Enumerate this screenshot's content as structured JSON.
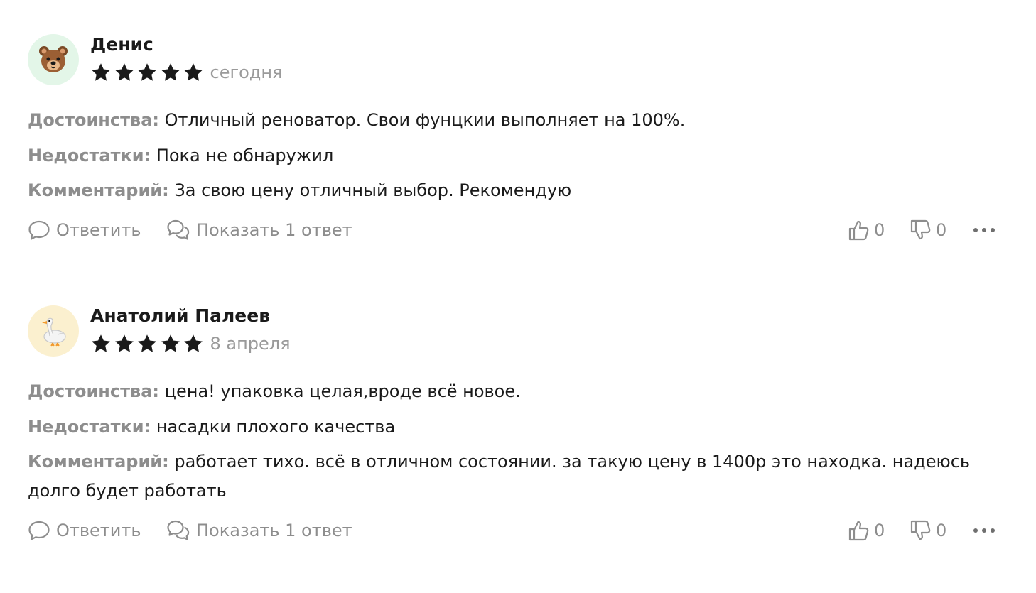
{
  "reviews": [
    {
      "author": "Денис",
      "avatar_icon": "bear-emoji-icon",
      "avatar_bg": "#e3f6e8",
      "rating": 5,
      "date": "сегодня",
      "pros_label": "Достоинства:",
      "pros": "Отличный реноватор. Свои фунцкии выполняет на 100%.",
      "cons_label": "Недостатки:",
      "cons": "Пока не обнаружил",
      "comment_label": "Комментарий:",
      "comment": "За свою цену отличный выбор. Рекомендую",
      "reply_label": "Ответить",
      "show_replies_label": "Показать 1 ответ",
      "likes": "0",
      "dislikes": "0"
    },
    {
      "author": "Анатолий Палеев",
      "avatar_icon": "goose-emoji-icon",
      "avatar_bg": "#fbf0cf",
      "rating": 5,
      "date": "8 апреля",
      "pros_label": "Достоинства:",
      "pros": "цена! упаковка целая,вроде всё новое.",
      "cons_label": "Недостатки:",
      "cons": "насадки плохого качества",
      "comment_label": "Комментарий:",
      "comment": "работает тихо. всё в отличном состоянии. за такую цену в 1400р это находка. надеюсь долго будет работать",
      "reply_label": "Ответить",
      "show_replies_label": "Показать 1 ответ",
      "likes": "0",
      "dislikes": "0"
    }
  ],
  "colors": {
    "label_gray": "#8d8d8d",
    "text": "#1a1a1a",
    "date_gray": "#9a9a9a",
    "star": "#1a1a1a",
    "divider": "#ececec"
  }
}
